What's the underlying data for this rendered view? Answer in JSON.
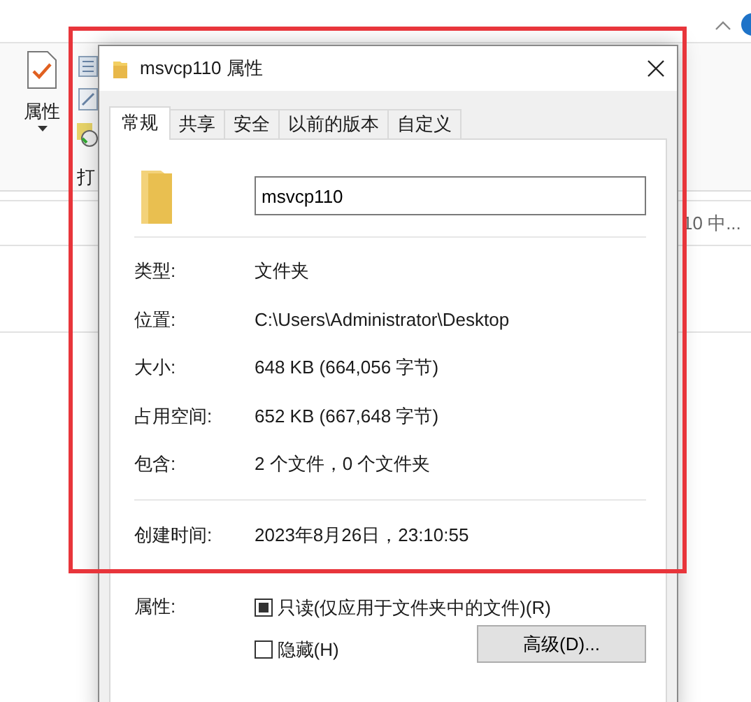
{
  "explorer": {
    "ribbon_button": "属性",
    "ribbon_label": "打",
    "list_text": "10 中..."
  },
  "dialog": {
    "title": "msvcp110 属性",
    "tabs": [
      {
        "label": "常规",
        "selected": true
      },
      {
        "label": "共享",
        "selected": false
      },
      {
        "label": "安全",
        "selected": false
      },
      {
        "label": "以前的版本",
        "selected": false
      },
      {
        "label": "自定义",
        "selected": false
      }
    ],
    "name_value": "msvcp110",
    "details": [
      {
        "label": "类型:",
        "value": "文件夹"
      },
      {
        "label": "位置:",
        "value": "C:\\Users\\Administrator\\Desktop"
      },
      {
        "label": "大小:",
        "value": "648 KB (664,056 字节)"
      },
      {
        "label": "占用空间:",
        "value": "652 KB (667,648 字节)"
      },
      {
        "label": "包含:",
        "value": "2 个文件，0 个文件夹"
      }
    ],
    "created": {
      "label": "创建时间:",
      "value": "2023年8月26日，23:10:55"
    },
    "attributes": {
      "label": "属性:",
      "options": [
        {
          "label": "只读(仅应用于文件夹中的文件)(R)",
          "checked": false,
          "indeterminate": true
        },
        {
          "label": "隐藏(H)",
          "checked": false,
          "indeterminate": false
        }
      ],
      "advanced_button": "高级(D)..."
    }
  }
}
